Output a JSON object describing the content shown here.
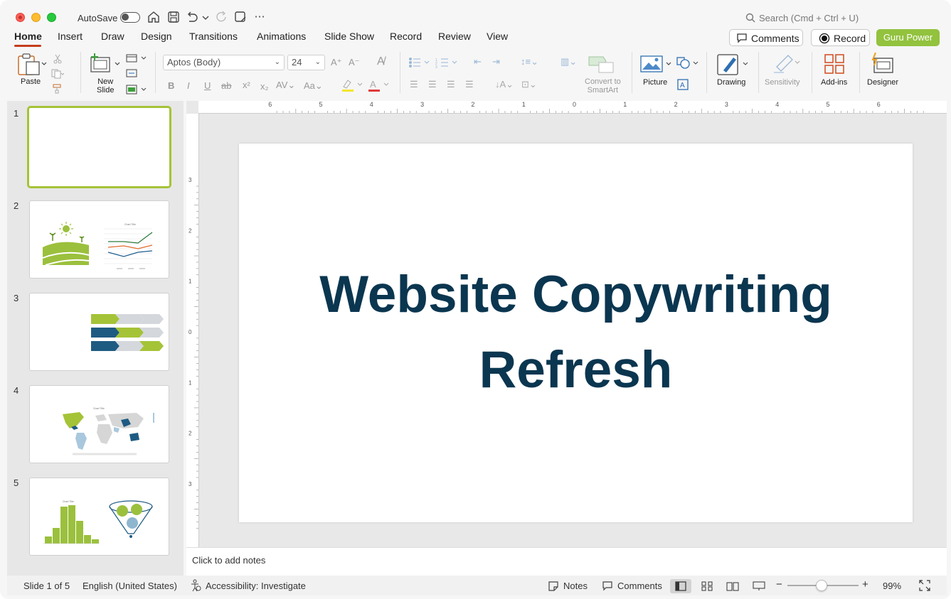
{
  "titlebar": {
    "autosave_label": "AutoSave",
    "search_placeholder": "Search (Cmd + Ctrl + U)"
  },
  "tabs": [
    "Home",
    "Insert",
    "Draw",
    "Design",
    "Transitions",
    "Animations",
    "Slide Show",
    "Record",
    "Review",
    "View"
  ],
  "actions": {
    "comments": "Comments",
    "record": "Record",
    "guru": "Guru Power"
  },
  "ribbon": {
    "paste": "Paste",
    "new_slide": "New\nSlide",
    "new_slide_l1": "New",
    "new_slide_l2": "Slide",
    "font_name": "Aptos (Body)",
    "font_size": "24",
    "smartart_l1": "Convert to",
    "smartart_l2": "SmartArt",
    "picture": "Picture",
    "drawing": "Drawing",
    "sensitivity": "Sensitivity",
    "addins": "Add-ins",
    "designer": "Designer"
  },
  "slides": [
    {
      "number": "1"
    },
    {
      "number": "2",
      "chart_title": "Chart Title"
    },
    {
      "number": "3"
    },
    {
      "number": "4",
      "chart_title": "Chart Title"
    },
    {
      "number": "5",
      "chart_title": "Chart Title"
    }
  ],
  "slide": {
    "title_line1": "Website Copywriting",
    "title_line2": "Refresh"
  },
  "notes_placeholder": "Click to add notes",
  "ruler": {
    "h_ticks": [
      "6",
      "5",
      "4",
      "3",
      "2",
      "1",
      "0",
      "1",
      "2",
      "3",
      "4",
      "5",
      "6"
    ],
    "v_ticks": [
      "3",
      "2",
      "1",
      "0",
      "1",
      "2",
      "3"
    ]
  },
  "status": {
    "slide_count": "Slide 1 of 5",
    "language": "English (United States)",
    "accessibility": "Accessibility: Investigate",
    "notes": "Notes",
    "comments": "Comments",
    "zoom": "99%"
  },
  "colors": {
    "accent_underline": "#c43e1c",
    "guru_green": "#92c23e",
    "slide_title": "#0b3650",
    "thumb_selected": "#a5c337"
  }
}
